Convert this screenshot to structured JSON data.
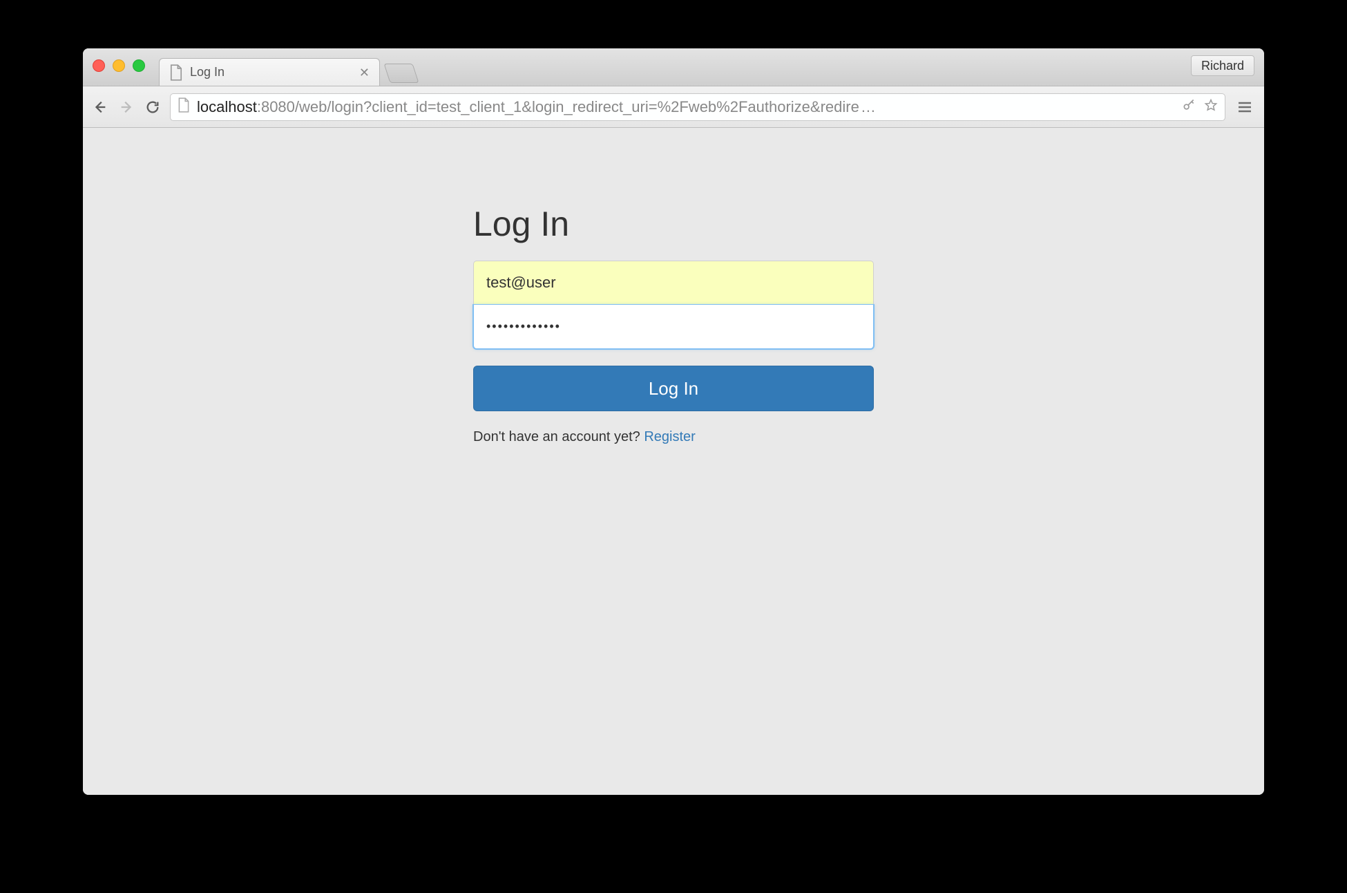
{
  "browser": {
    "profile_name": "Richard",
    "tab": {
      "title": "Log In"
    },
    "url": {
      "host": "localhost",
      "port_and_path": ":8080/web/login?client_id=test_client_1&login_redirect_uri=%2Fweb%2Fauthorize&redire",
      "truncation": "…"
    }
  },
  "page": {
    "heading": "Log In",
    "username_value": "test@user",
    "password_value": "•••••••••••••",
    "submit_label": "Log In",
    "signup_prompt": "Don't have an account yet? ",
    "signup_link_label": "Register"
  }
}
